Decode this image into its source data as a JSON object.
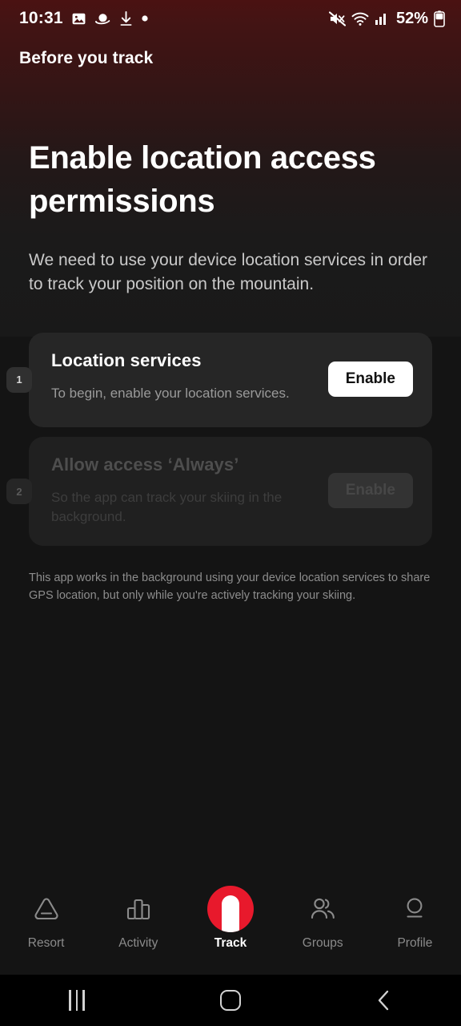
{
  "status_bar": {
    "time": "10:31",
    "left_icons": [
      "image-icon",
      "saturn-icon",
      "download-icon",
      "dot-icon"
    ],
    "right_icons": [
      "mute-icon",
      "wifi-icon",
      "cellular-signal-icon"
    ],
    "battery_percent": "52%"
  },
  "app_bar": {
    "title": "Before you track"
  },
  "main": {
    "headline": "Enable location access permissions",
    "subhead": "We need to use your device location services in order to track your position on the mountain.",
    "footnote": "This app works in the background using your device location services to share GPS location, but only while you're actively tracking your skiing.",
    "steps": [
      {
        "number": "1",
        "title": "Location services",
        "description": "To begin, enable your location services.",
        "button_label": "Enable",
        "enabled": true
      },
      {
        "number": "2",
        "title": "Allow access ‘Always’",
        "description": "So the app can track your skiing in the background.",
        "button_label": "Enable",
        "enabled": false
      }
    ]
  },
  "tab_bar": {
    "active": "Track",
    "accent_color": "#E8192C",
    "items": [
      {
        "label": "Resort",
        "icon": "mountain-icon"
      },
      {
        "label": "Activity",
        "icon": "bar-chart-icon"
      },
      {
        "label": "Track",
        "icon": "track-icon"
      },
      {
        "label": "Groups",
        "icon": "people-icon"
      },
      {
        "label": "Profile",
        "icon": "person-icon"
      }
    ]
  },
  "system_nav": {
    "recents_label": "Recents",
    "home_label": "Home",
    "back_label": "Back"
  }
}
